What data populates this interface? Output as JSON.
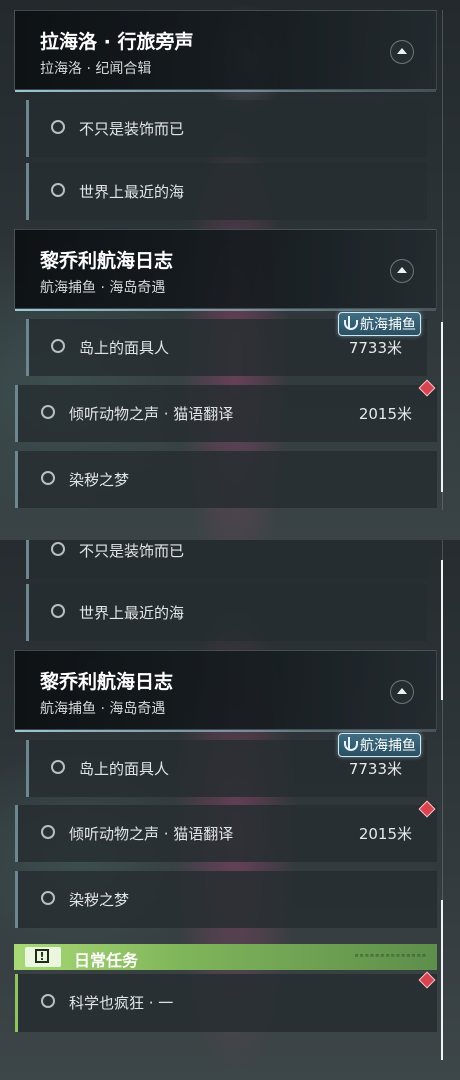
{
  "top": {
    "header1": {
      "title": "拉海洛 · 行旅旁声",
      "subtitle": "拉海洛 · 纪闻合辑"
    },
    "rows1": [
      {
        "label": "不只是装饰而已"
      },
      {
        "label": "世界上最近的海"
      }
    ],
    "header2": {
      "title": "黎乔利航海日志",
      "subtitle": "航海捕鱼 · 海岛奇遇"
    },
    "badge": "航海捕鱼",
    "rows2": [
      {
        "label": "岛上的面具人",
        "distance": "7733米"
      },
      {
        "label": "倾听动物之声 · 猫语翻译",
        "distance": "2015米"
      },
      {
        "label": "染秽之梦"
      }
    ]
  },
  "bottom": {
    "rows1": [
      {
        "label": "不只是装饰而已"
      },
      {
        "label": "世界上最近的海"
      }
    ],
    "header2": {
      "title": "黎乔利航海日志",
      "subtitle": "航海捕鱼 · 海岛奇遇"
    },
    "badge": "航海捕鱼",
    "rows2": [
      {
        "label": "岛上的面具人",
        "distance": "7733米"
      },
      {
        "label": "倾听动物之声 · 猫语翻译",
        "distance": "2015米"
      },
      {
        "label": "染秽之梦"
      }
    ],
    "daily": {
      "title": "日常任务",
      "icon": "!"
    },
    "daily_rows": [
      {
        "label": "科学也疯狂 · 一"
      }
    ]
  },
  "icons": {
    "collapse": "chevron-up-icon",
    "quest_marker": "circle-icon",
    "badge": "anchor-icon",
    "tracking": "diamond-icon",
    "daily": "exclamation-icon"
  },
  "colors": {
    "daily_accent": "#a9d976",
    "marker_red": "#d8434f",
    "badge_blue": "#3f6e85"
  }
}
